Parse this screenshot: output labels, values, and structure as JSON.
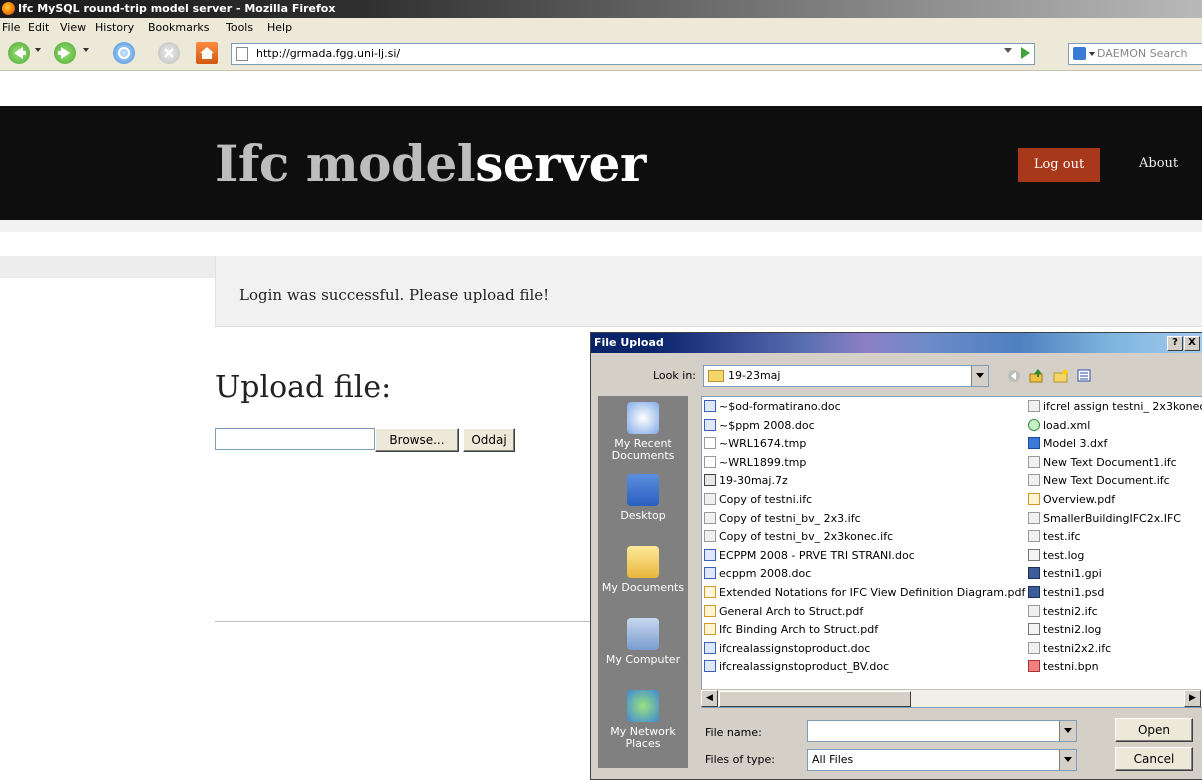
{
  "window": {
    "title": "Ifc MySQL round-trip model server - Mozilla Firefox"
  },
  "menu": [
    "File",
    "Edit",
    "View",
    "History",
    "Bookmarks",
    "Tools",
    "Help"
  ],
  "nav": {
    "url": "http://grmada.fgg.uni-lj.si/",
    "search_placeholder": "DAEMON Search"
  },
  "site": {
    "title_light": "Ifc model",
    "title_bold": "server",
    "logout": "Log out",
    "about": "About",
    "message": "Login was successful. Please upload file!",
    "upload_heading": "Upload file:",
    "browse": "Browse...",
    "submit": "Oddaj"
  },
  "dialog": {
    "title": "File Upload",
    "help": "?",
    "close": "X",
    "look_in_label": "Look in:",
    "look_in_value": "19-23maj",
    "places": [
      "My Recent Documents",
      "Desktop",
      "My Documents",
      "My Computer",
      "My Network Places"
    ],
    "files_col1": [
      {
        "name": "~$od-formatirano.doc",
        "icon": "word"
      },
      {
        "name": "~$ppm 2008.doc",
        "icon": "word"
      },
      {
        "name": "~WRL1674.tmp",
        "icon": "tmp"
      },
      {
        "name": "~WRL1899.tmp",
        "icon": "tmp"
      },
      {
        "name": "19-30maj.7z",
        "icon": "zip"
      },
      {
        "name": "Copy of testni.ifc",
        "icon": "ifc"
      },
      {
        "name": "Copy of testni_bv_ 2x3.ifc",
        "icon": "ifc"
      },
      {
        "name": "Copy of testni_bv_ 2x3konec.ifc",
        "icon": "ifc"
      },
      {
        "name": "ECPPM 2008 - PRVE TRI STRANI.doc",
        "icon": "word"
      },
      {
        "name": "ecppm 2008.doc",
        "icon": "word"
      },
      {
        "name": "Extended Notations for IFC View Definition Diagram.pdf",
        "icon": "pdf"
      },
      {
        "name": "General Arch to Struct.pdf",
        "icon": "pdf"
      },
      {
        "name": "Ifc Binding Arch to Struct.pdf",
        "icon": "pdf"
      },
      {
        "name": "ifcrealassignstoproduct.doc",
        "icon": "word"
      },
      {
        "name": "ifcrealassignstoproduct_BV.doc",
        "icon": "word"
      }
    ],
    "files_col2": [
      {
        "name": "ifcrel assign testni_ 2x3konec",
        "icon": "ifc"
      },
      {
        "name": "load.xml",
        "icon": "xml"
      },
      {
        "name": "Model 3.dxf",
        "icon": "dxf"
      },
      {
        "name": "New Text Document1.ifc",
        "icon": "ifc"
      },
      {
        "name": "New Text Document.ifc",
        "icon": "ifc"
      },
      {
        "name": "Overview.pdf",
        "icon": "pdf"
      },
      {
        "name": "SmallerBuildingIFC2x.IFC",
        "icon": "ifc"
      },
      {
        "name": "test.ifc",
        "icon": "ifc"
      },
      {
        "name": "test.log",
        "icon": "log"
      },
      {
        "name": "testni1.gpi",
        "icon": "gpi"
      },
      {
        "name": "testni1.psd",
        "icon": "gpi"
      },
      {
        "name": "testni2.ifc",
        "icon": "ifc"
      },
      {
        "name": "testni2.log",
        "icon": "log"
      },
      {
        "name": "testni2x2.ifc",
        "icon": "ifc"
      },
      {
        "name": "testni.bpn",
        "icon": "bpn"
      }
    ],
    "file_name_label": "File name:",
    "file_name_value": "",
    "file_type_label": "Files of type:",
    "file_type_value": "All Files",
    "open": "Open",
    "cancel": "Cancel"
  }
}
